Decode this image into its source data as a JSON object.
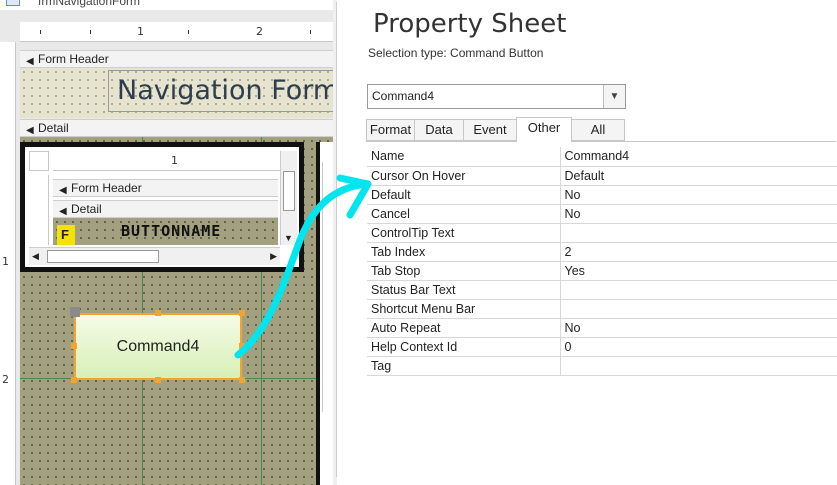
{
  "designer": {
    "tab_title": "frmNavigationForm",
    "ruler_top": [
      "1",
      "2"
    ],
    "ruler_left": [
      "1",
      "2"
    ],
    "form_header_label": "Form Header",
    "nav_title": "Navigation Form",
    "detail_label": "Detail",
    "subform": {
      "ruler_num": "1",
      "form_header_label": "Form Header",
      "detail_label": "Detail",
      "field_letter": "F",
      "button_name": "BUTTONNAME"
    },
    "command_button_label": "Command4"
  },
  "property_sheet": {
    "title": "Property Sheet",
    "selection_type": "Selection type:  Command Button",
    "selected_object": "Command4",
    "tabs": [
      {
        "label": "Format",
        "active": false
      },
      {
        "label": "Data",
        "active": false
      },
      {
        "label": "Event",
        "active": false
      },
      {
        "label": "Other",
        "active": true
      },
      {
        "label": "All",
        "active": false
      }
    ],
    "properties": [
      {
        "name": "Name",
        "value": "Command4"
      },
      {
        "name": "Cursor On Hover",
        "value": "Default"
      },
      {
        "name": "Default",
        "value": "No"
      },
      {
        "name": "Cancel",
        "value": "No"
      },
      {
        "name": "ControlTip Text",
        "value": ""
      },
      {
        "name": "Tab Index",
        "value": "2"
      },
      {
        "name": "Tab Stop",
        "value": "Yes"
      },
      {
        "name": "Status Bar Text",
        "value": ""
      },
      {
        "name": "Shortcut Menu Bar",
        "value": ""
      },
      {
        "name": "Auto Repeat",
        "value": "No"
      },
      {
        "name": "Help Context Id",
        "value": "0"
      },
      {
        "name": "Tag",
        "value": ""
      }
    ]
  },
  "colors": {
    "selection_handle": "#f5a330",
    "annotation_arrow": "#00e5ee",
    "button_fill": "#e3f5c8"
  }
}
